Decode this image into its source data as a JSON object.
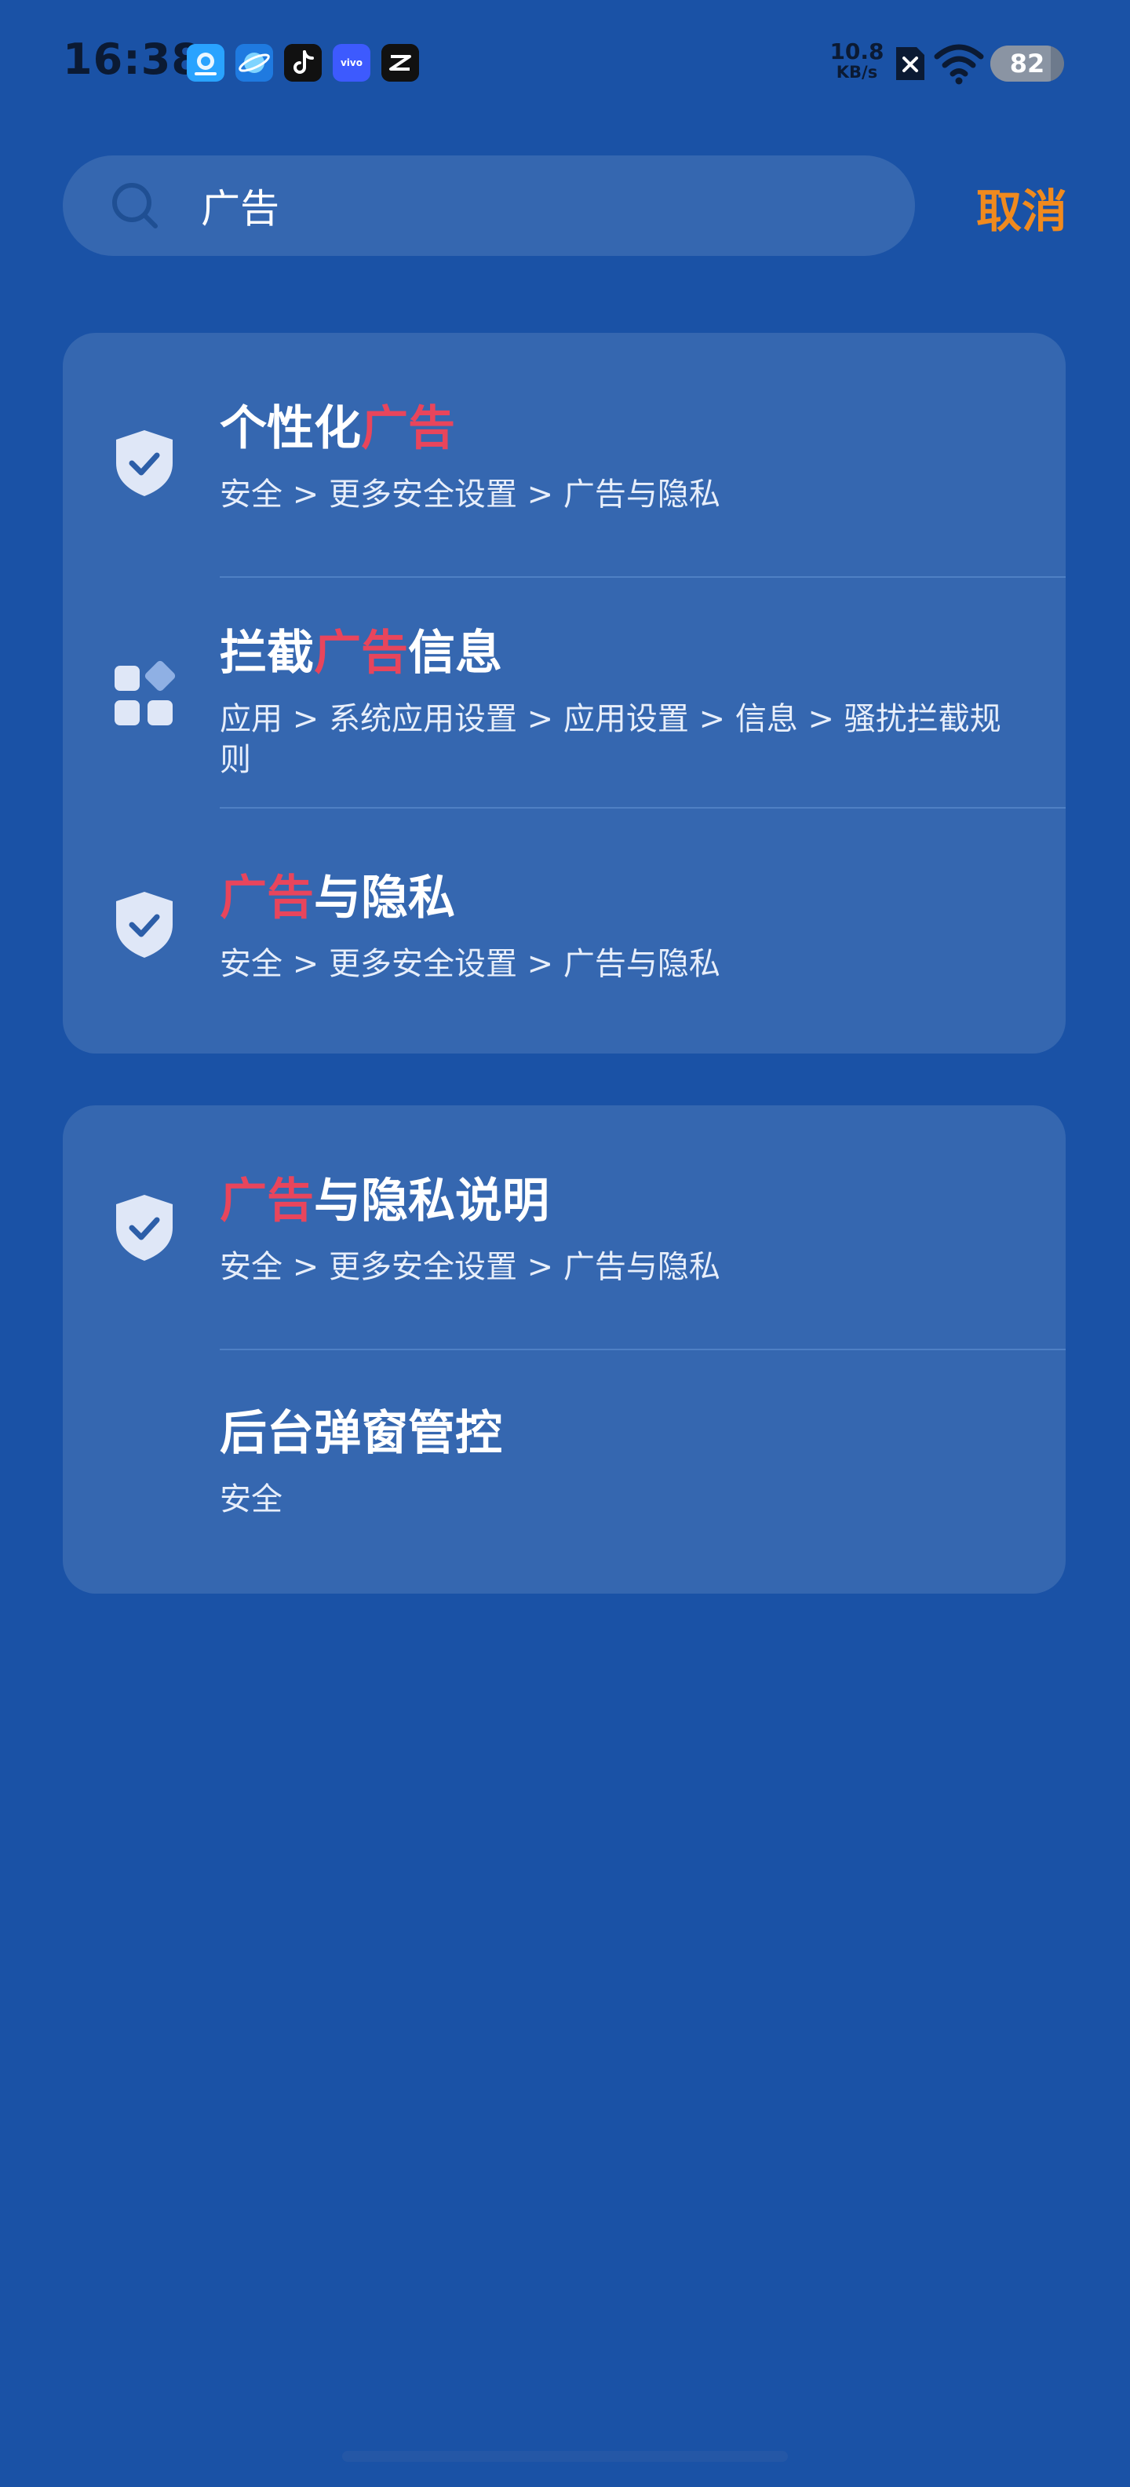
{
  "status_bar": {
    "time": "16:38",
    "apps": [
      {
        "name": "browser-app-icon",
        "color": "#1e90ff",
        "glyph": "◐"
      },
      {
        "name": "planet-app-icon",
        "color": "#1976d2",
        "glyph": "●"
      },
      {
        "name": "tiktok-app-icon",
        "color": "#111111",
        "glyph": "♪"
      },
      {
        "name": "vivo-app-icon",
        "color": "#3d5afe",
        "glyph": "vivo"
      },
      {
        "name": "capcut-app-icon",
        "color": "#111111",
        "glyph": "✂"
      }
    ],
    "net_speed_value": "10.8",
    "net_speed_unit": "KB/s",
    "battery_level": "82",
    "battery_fraction": 0.82
  },
  "search": {
    "query": "广告",
    "cancel_label": "取消"
  },
  "results": [
    {
      "title_before": "个性化",
      "title_highlight": "广告",
      "title_after": "",
      "path": "安全 > 更多安全设置 > 广告与隐私",
      "icon": "shield-check-icon"
    },
    {
      "title_before": "拦截",
      "title_highlight": "广告",
      "title_after": "信息",
      "path": "应用 > 系统应用设置 > 应用设置 > 信息 > 骚扰拦截规则",
      "icon": "apps-grid-icon"
    },
    {
      "title_before": "",
      "title_highlight": "广告",
      "title_after": "与隐私",
      "path": "安全 > 更多安全设置 > 广告与隐私",
      "icon": "shield-check-icon"
    },
    {
      "title_before": "",
      "title_highlight": "广告",
      "title_after": "与隐私说明",
      "path": "安全 > 更多安全设置 > 广告与隐私",
      "icon": "shield-check-icon"
    },
    {
      "title_before": "后台弹窗管控",
      "title_highlight": "",
      "title_after": "",
      "path": "安全",
      "icon": ""
    }
  ],
  "colors": {
    "background": "#1a52a6",
    "card": "#3567b0",
    "highlight": "#e8455c",
    "cancel": "#f08a1e"
  }
}
